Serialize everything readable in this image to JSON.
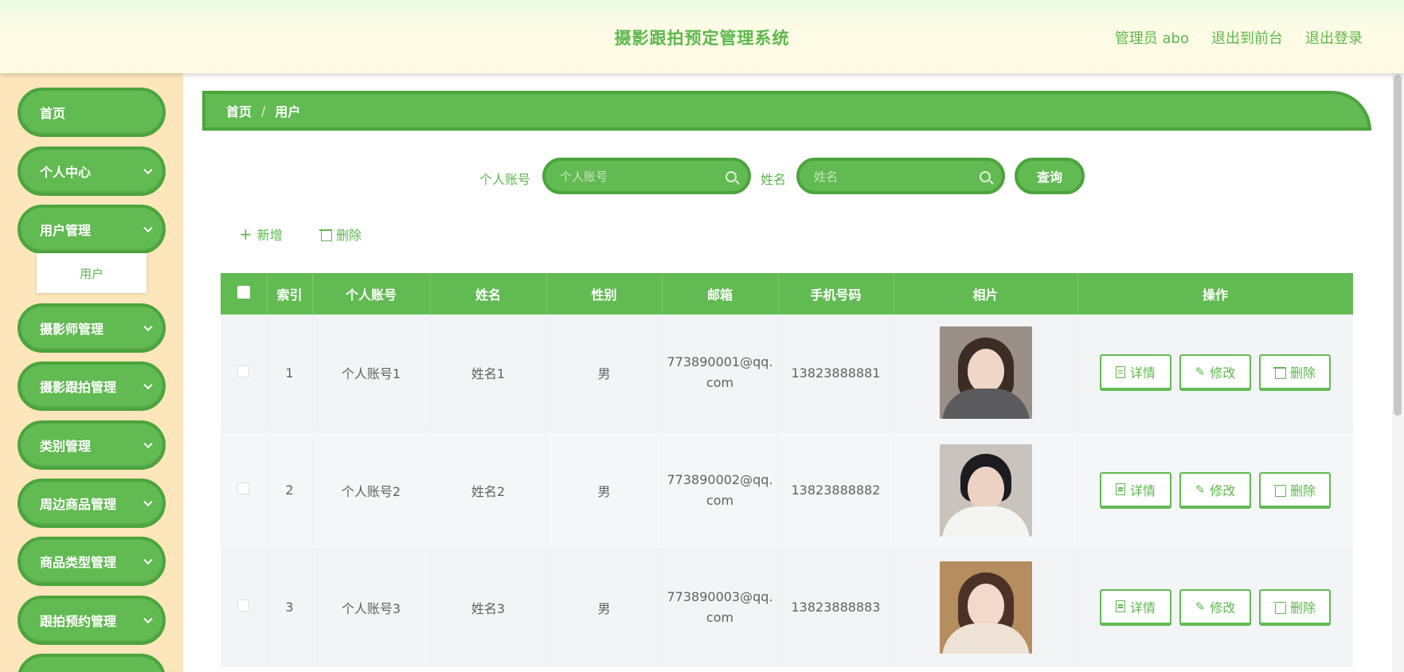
{
  "header": {
    "title": "摄影跟拍预定管理系统",
    "admin": "管理员 abo",
    "to_front": "退出到前台",
    "logout": "退出登录"
  },
  "sidebar": {
    "items": [
      {
        "label": "首页"
      },
      {
        "label": "个人中心"
      },
      {
        "label": "用户管理"
      },
      {
        "label": "摄影师管理"
      },
      {
        "label": "摄影跟拍管理"
      },
      {
        "label": "类别管理"
      },
      {
        "label": "周边商品管理"
      },
      {
        "label": "商品类型管理"
      },
      {
        "label": "跟拍预约管理"
      }
    ],
    "sub_item": "用户"
  },
  "breadcrumb": {
    "home": "首页",
    "sep": "/",
    "current": "用户"
  },
  "search": {
    "account_label": "个人账号",
    "account_placeholder": "个人账号",
    "name_label": "姓名",
    "name_placeholder": "姓名",
    "query": "查询"
  },
  "toolbar": {
    "add": "新增",
    "delete": "删除"
  },
  "table": {
    "headers": [
      "索引",
      "个人账号",
      "姓名",
      "性别",
      "邮箱",
      "手机号码",
      "相片",
      "操作"
    ],
    "rows": [
      {
        "index": "1",
        "account": "个人账号1",
        "name": "姓名1",
        "gender": "男",
        "email_a": "773890001@qq.",
        "email_b": "com",
        "phone": "13823888881"
      },
      {
        "index": "2",
        "account": "个人账号2",
        "name": "姓名2",
        "gender": "男",
        "email_a": "773890002@qq.",
        "email_b": "com",
        "phone": "13823888882"
      },
      {
        "index": "3",
        "account": "个人账号3",
        "name": "姓名3",
        "gender": "男",
        "email_a": "773890003@qq.",
        "email_b": "com",
        "phone": "13823888883"
      }
    ],
    "actions": {
      "detail": "详情",
      "edit": "修改",
      "delete": "删除"
    }
  },
  "colors": {
    "accent": "#62ba52",
    "accent_dark": "#4ca43d",
    "sidebar_bg": "#fde6bb"
  }
}
